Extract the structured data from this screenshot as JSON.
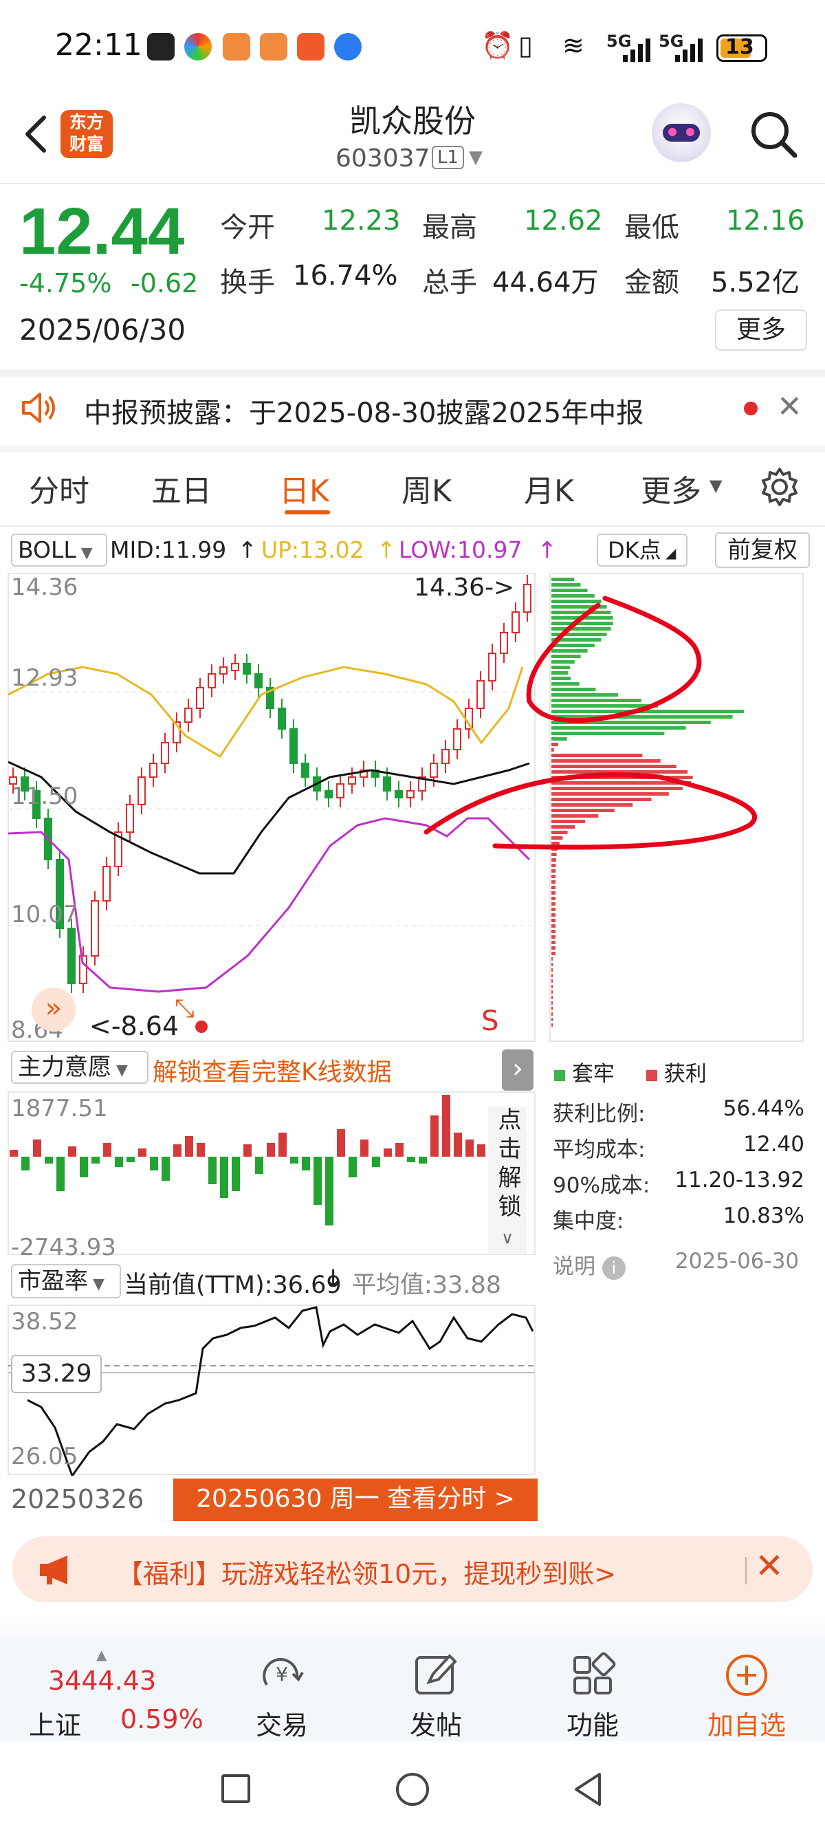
{
  "status": {
    "time": "22:11",
    "signal1": "5G",
    "signal2": "5G",
    "battery": "13"
  },
  "header": {
    "logo_line1": "东方",
    "logo_line2": "财富",
    "stock_name": "凯众股份",
    "stock_code": "603037",
    "level_badge": "L1"
  },
  "quote": {
    "price": "12.44",
    "change_pct": "-4.75%",
    "change": "-0.62",
    "date": "2025/06/30",
    "open_label": "今开",
    "open": "12.23",
    "high_label": "最高",
    "high": "12.62",
    "low_label": "最低",
    "low": "12.16",
    "turnover_label": "换手",
    "turnover": "16.74%",
    "volume_label": "总手",
    "volume": "44.64万",
    "amount_label": "金额",
    "amount": "5.52亿",
    "more": "更多"
  },
  "notice": {
    "text": "中报预披露：于2025-08-30披露2025年中报"
  },
  "tabs": [
    "分时",
    "五日",
    "日K",
    "周K",
    "月K",
    "更多"
  ],
  "active_tab": "日K",
  "indicator": {
    "name": "BOLL",
    "mid": "MID:11.99",
    "up": "UP:13.02",
    "low": "LOW:10.97",
    "dk": "DK点",
    "adjust": "前复权"
  },
  "kline": {
    "y_labels": [
      "14.36",
      "12.93",
      "11.50",
      "10.07",
      "8.64"
    ],
    "max_marker": "14.36->",
    "min_marker": "<-8.64",
    "s_marker": "S"
  },
  "chips": {
    "legend_trapped": "套牢",
    "legend_profit": "获利",
    "profit_ratio_label": "获利比例:",
    "profit_ratio": "56.44%",
    "avg_cost_label": "平均成本:",
    "avg_cost": "12.40",
    "cost90_label": "90%成本:",
    "cost90": "11.20-13.92",
    "concentration_label": "集中度:",
    "concentration": "10.83%",
    "note_label": "说明",
    "date": "2025-06-30"
  },
  "main_force": {
    "name": "主力意愿",
    "unlock": "解锁查看完整K线数据",
    "top": "1877.51",
    "bottom": "-2743.93",
    "vertical": "点击解锁"
  },
  "pe": {
    "name": "市盈率",
    "current": "当前值(TTM):36.69",
    "average": "平均值:33.88",
    "top": "38.52",
    "bottom": "26.05",
    "mark": "33.29",
    "start_date": "20250326",
    "end_button": "20250630 周一 查看分时 >"
  },
  "ad": {
    "text": "【福利】玩游戏轻松领10元，提现秒到账>"
  },
  "bottom_nav": {
    "index_value": "3444.43",
    "index_name": "上证",
    "index_pct": "0.59%",
    "trade": "交易",
    "post": "发帖",
    "function": "功能",
    "add": "加自选"
  },
  "colors": {
    "up": "#e02b2b",
    "down": "#1e9e3a",
    "accent": "#e85d10",
    "boll_up": "#e8b820",
    "boll_low": "#c030c8"
  }
}
